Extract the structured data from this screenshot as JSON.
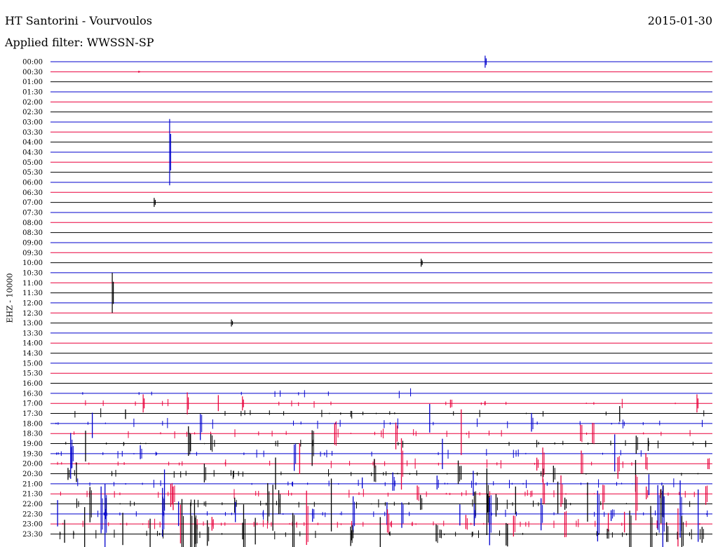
{
  "header": {
    "title": "HT Santorini - Vourvoulos",
    "date": "2015-01-30",
    "filter": "Applied filter: WWSSN-SP"
  },
  "chart_data": {
    "type": "line",
    "title": "HT Santorini - Vourvoulos",
    "subtitle": "Applied filter: WWSSN-SP",
    "ylabel": "EHZ - 10000",
    "xlabel": "",
    "colors": [
      "#0000cc",
      "#e8003c",
      "#000000"
    ],
    "row_labels": [
      "00:00",
      "00:30",
      "01:00",
      "01:30",
      "02:00",
      "02:30",
      "03:00",
      "03:30",
      "04:00",
      "04:30",
      "05:00",
      "05:30",
      "06:00",
      "06:30",
      "07:00",
      "07:30",
      "08:00",
      "08:30",
      "09:00",
      "09:30",
      "10:00",
      "10:30",
      "11:00",
      "11:30",
      "12:00",
      "12:30",
      "13:00",
      "13:30",
      "14:00",
      "14:30",
      "15:00",
      "15:30",
      "16:00",
      "16:30",
      "17:00",
      "17:30",
      "18:00",
      "18:30",
      "19:00",
      "19:30",
      "20:00",
      "20:30",
      "21:00",
      "21:30",
      "22:00",
      "22:30",
      "23:00",
      "23:30"
    ],
    "x_range_minutes": [
      0,
      30
    ],
    "amplitude_unit": "trace row spacings",
    "events": [
      {
        "row": 0,
        "minute": 19.7,
        "amp": 0.6
      },
      {
        "row": 1,
        "minute": 4.0,
        "amp": 0.1
      },
      {
        "row": 9,
        "minute": 5.4,
        "amp": 3.3
      },
      {
        "row": 14,
        "minute": 4.7,
        "amp": 0.45
      },
      {
        "row": 20,
        "minute": 16.8,
        "amp": 0.4
      },
      {
        "row": 23,
        "minute": 2.8,
        "amp": 2.0
      },
      {
        "row": 26,
        "minute": 8.2,
        "amp": 0.35
      },
      {
        "row": 34,
        "minute": 4.2,
        "amp": 0.9
      },
      {
        "row": 34,
        "minute": 6.2,
        "amp": 1.1
      },
      {
        "row": 34,
        "minute": 8.7,
        "amp": 0.7
      },
      {
        "row": 34,
        "minute": 29.3,
        "amp": 0.9
      }
    ],
    "quiet_rows": "00:00-16:00",
    "active_rows": "16:30-23:30",
    "activity_level": [
      0,
      0,
      0,
      0,
      0,
      0,
      0,
      0,
      0,
      0,
      0,
      0,
      0,
      0,
      0,
      0,
      0,
      0,
      0,
      0,
      0,
      0,
      0,
      0,
      0,
      0,
      0,
      0,
      0,
      0,
      0,
      0,
      0,
      0.15,
      0.3,
      0.35,
      0.45,
      0.45,
      0.5,
      0.5,
      0.5,
      0.55,
      0.6,
      0.65,
      0.75,
      0.8,
      0.85,
      0.9
    ],
    "grid": "horizontal baselines"
  }
}
